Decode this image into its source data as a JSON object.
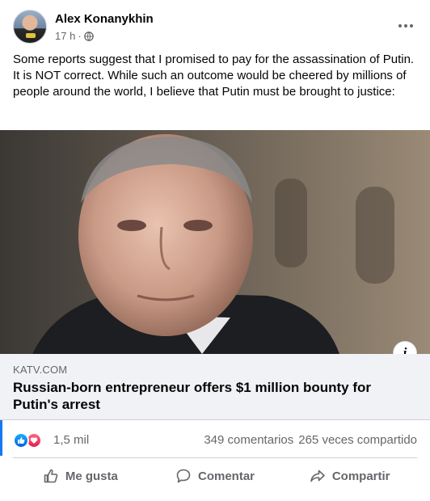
{
  "post": {
    "author": "Alex Konanykhin",
    "time": "17 h",
    "separator": "·",
    "text": "Some reports suggest that I promised to pay for the assassination of Putin. It is NOT correct. While such an outcome would be cheered by millions of people around the world, I believe that Putin must be brought to justice:"
  },
  "link": {
    "domain": "KATV.COM",
    "title": "Russian-born entrepreneur offers $1 million bounty for Putin's arrest",
    "info_glyph": "i"
  },
  "reactions": {
    "count": "1,5 mil",
    "comments": "349 comentarios",
    "shares": "265 veces compartido",
    "icons": [
      "like-reaction-icon",
      "love-reaction-icon"
    ]
  },
  "actions": {
    "like": "Me gusta",
    "comment": "Comentar",
    "share": "Compartir"
  },
  "colors": {
    "text": "#050505",
    "secondary": "#65676b",
    "link_bg": "#f0f2f5",
    "accent": "#1877f2"
  }
}
